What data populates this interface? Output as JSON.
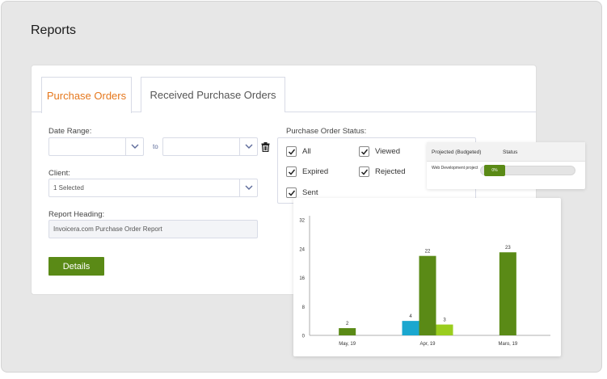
{
  "page": {
    "title": "Reports"
  },
  "tabs": [
    {
      "label": "Purchase Orders",
      "active": true
    },
    {
      "label": "Received Purchase Orders",
      "active": false
    }
  ],
  "form": {
    "date_range_label": "Date Range:",
    "date_from_value": "",
    "date_to_value": "",
    "to_label": "to",
    "client_label": "Client:",
    "client_value": "1 Selected",
    "report_heading_label": "Report Heading:",
    "report_heading_value": "Invoicera.com Purchase Order Report",
    "details_button": "Details"
  },
  "status": {
    "label": "Purchase Order Status:",
    "options": [
      {
        "label": "All",
        "checked": true
      },
      {
        "label": "Viewed",
        "checked": true
      },
      {
        "label": "Expired",
        "checked": true
      },
      {
        "label": "Rejected",
        "checked": true
      },
      {
        "label": "Sent",
        "checked": true
      }
    ]
  },
  "projects": {
    "col_project": "Projected (Budgeted)",
    "col_status": "Status",
    "rows": [
      {
        "name": "Web Development project",
        "progress_label": "0%",
        "progress": 0
      }
    ]
  },
  "chart_data": {
    "type": "bar",
    "categories": [
      "May, 19",
      "Apr, 19",
      "Maro, 19"
    ],
    "series": [
      {
        "values": [
          0,
          4,
          0
        ],
        "color": "#1aa7cf"
      },
      {
        "values": [
          2,
          22,
          23
        ],
        "color": "#5a8a16"
      },
      {
        "values": [
          0,
          3,
          0
        ],
        "color": "#9acd1e"
      }
    ],
    "data_labels": [
      [
        null,
        "4",
        null
      ],
      [
        "2",
        "22",
        "23"
      ],
      [
        null,
        "3",
        null
      ]
    ],
    "y_ticks": [
      0,
      8,
      16,
      24,
      32
    ],
    "ylim": [
      0,
      32
    ]
  },
  "colors": {
    "accent": "#e5771c",
    "primary_green": "#5a8a16",
    "light_green": "#9acd1e",
    "blue": "#1aa7cf"
  }
}
